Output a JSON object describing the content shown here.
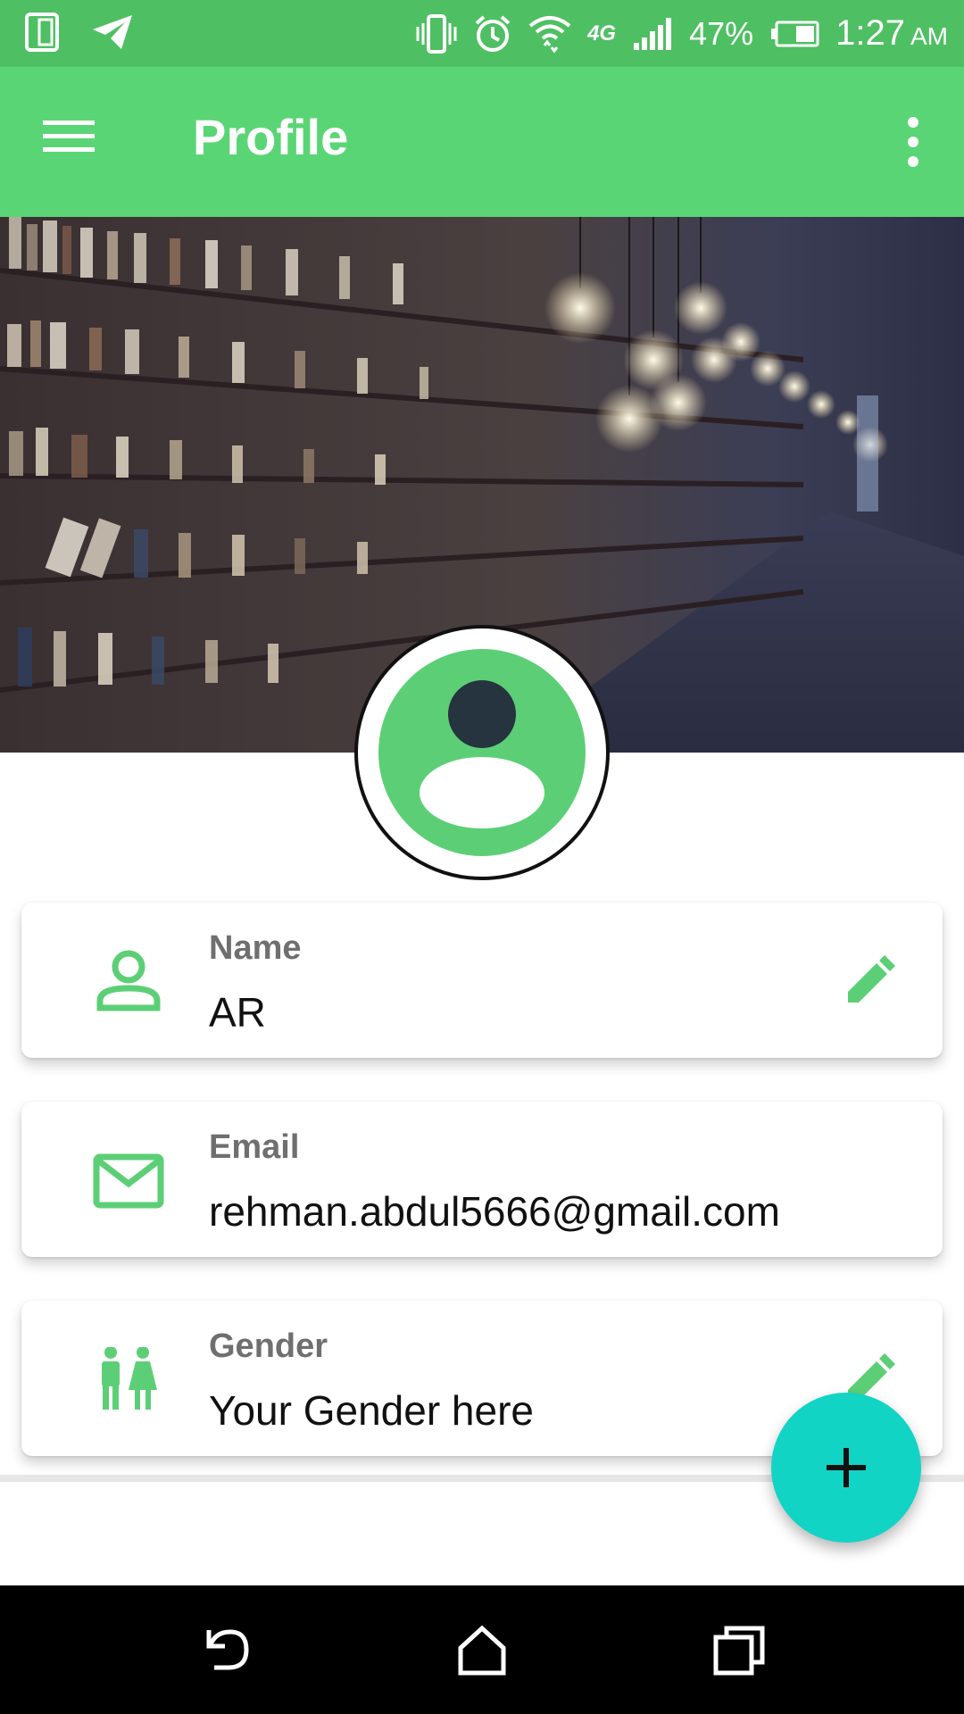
{
  "status_bar": {
    "battery": "47%",
    "time": "1:27",
    "ampm": "AM",
    "network": "4G",
    "icons": [
      "device-icon",
      "telegram-icon",
      "vibrate-icon",
      "alarm-icon",
      "wifi-icon",
      "signal-icon",
      "battery-icon"
    ]
  },
  "app_bar": {
    "title": "Profile",
    "menu_icon": "hamburger-menu-icon",
    "overflow_icon": "more-vert-icon"
  },
  "profile": {
    "cover_image": "library-bookshelf-photo",
    "avatar_icon": "account-circle-icon"
  },
  "fields": [
    {
      "label": "Name",
      "value": "AR",
      "icon": "person-icon",
      "editable": true
    },
    {
      "label": "Email",
      "value": "rehman.abdul5666@gmail.com",
      "icon": "mail-icon",
      "editable": false
    },
    {
      "label": "Gender",
      "value": "Your Gender here",
      "icon": "people-icon",
      "editable": true
    }
  ],
  "fab": {
    "icon": "plus-icon"
  },
  "nav_bar": {
    "buttons": [
      "back-icon",
      "home-icon",
      "recents-icon"
    ]
  },
  "colors": {
    "status_bar": "#4fbf63",
    "app_bar": "#5ad575",
    "accent_green": "#5ccf76",
    "fab": "#12d4c4",
    "label_gray": "#6f6f6f"
  }
}
